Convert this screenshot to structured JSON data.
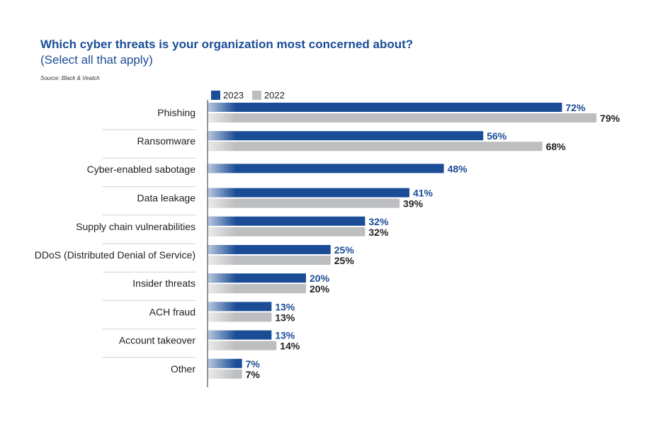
{
  "chart_data": {
    "type": "bar",
    "orientation": "horizontal",
    "title": "Which cyber threats is your organization most concerned about?",
    "subtitle": "(Select all that apply)",
    "source": "Source: Black & Veatch",
    "xlabel": "",
    "ylabel": "",
    "xlim": [
      0,
      100
    ],
    "grid": false,
    "legend_position": "top-left",
    "value_suffix": "%",
    "categories": [
      "Phishing",
      "Ransomware",
      "Cyber-enabled sabotage",
      "Data leakage",
      "Supply chain vulnerabilities",
      "DDoS (Distributed Denial of Service)",
      "Insider threats",
      "ACH fraud",
      "Account takeover",
      "Other"
    ],
    "series": [
      {
        "name": "2023",
        "color": "#1b4d96",
        "label_color": "#1b4d96",
        "values": [
          72,
          56,
          48,
          41,
          32,
          25,
          20,
          13,
          13,
          7
        ]
      },
      {
        "name": "2022",
        "color": "#bdbec0",
        "label_color": "#222222",
        "values": [
          79,
          68,
          null,
          39,
          32,
          25,
          20,
          13,
          14,
          7
        ]
      }
    ]
  }
}
